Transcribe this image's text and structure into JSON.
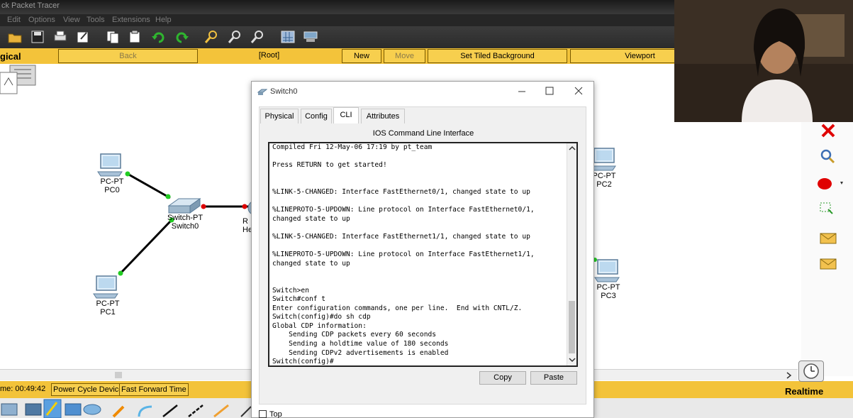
{
  "app": {
    "title_fragment": "ck Packet Tracer",
    "menu": [
      "Edit",
      "Options",
      "View",
      "Tools",
      "Extensions",
      "Help"
    ]
  },
  "workspace": {
    "mode_label": "gical",
    "nav": {
      "back": "Back",
      "root": "[Root]",
      "new_cluster": "New Cluster",
      "move_object": "Move Object",
      "set_tiled_background": "Set Tiled Background",
      "viewport": "Viewport"
    },
    "devices": [
      {
        "type": "PC-PT",
        "name": "PC0"
      },
      {
        "type": "PC-PT",
        "name": "PC1"
      },
      {
        "type": "Switch-PT",
        "name": "Switch0"
      },
      {
        "type": "PC-PT",
        "name": "PC2"
      },
      {
        "type": "PC-PT",
        "name": "PC3"
      }
    ],
    "partial_router_label": {
      "line1": "R",
      "line2": "He"
    }
  },
  "status": {
    "time": "me: 00:49:42",
    "power_cycle": "Power Cycle Devices",
    "fast_forward": "Fast Forward Time",
    "mode": "Realtime"
  },
  "colors": {
    "workspace_bar": "#f3c33a",
    "link_up": "#22cc22",
    "link_down": "#dd0000",
    "delete_tool": "#e00000"
  },
  "icons": {
    "palette": [
      "close-x-icon",
      "inspect-magnifier-icon",
      "draw-ellipse-icon",
      "resize-select-icon",
      "simple-pdu-icon",
      "complex-pdu-icon"
    ]
  },
  "dialog": {
    "title": "Switch0",
    "tabs": [
      "Physical",
      "Config",
      "CLI",
      "Attributes"
    ],
    "active_tab": "CLI",
    "heading": "IOS Command Line Interface",
    "terminal_lines": [
      "Compiled Fri 12-May-06 17:19 by pt_team",
      "",
      "Press RETURN to get started!",
      "",
      "",
      "%LINK-5-CHANGED: Interface FastEthernet0/1, changed state to up",
      "",
      "%LINEPROTO-5-UPDOWN: Line protocol on Interface FastEthernet0/1,",
      "changed state to up",
      "",
      "%LINK-5-CHANGED: Interface FastEthernet1/1, changed state to up",
      "",
      "%LINEPROTO-5-UPDOWN: Line protocol on Interface FastEthernet1/1,",
      "changed state to up",
      "",
      "",
      "Switch>en",
      "Switch#conf t",
      "Enter configuration commands, one per line.  End with CNTL/Z.",
      "Switch(config)#do sh cdp",
      "Global CDP information:",
      "    Sending CDP packets every 60 seconds",
      "    Sending a holdtime value of 180 seconds",
      "    Sending CDPv2 advertisements is enabled",
      "Switch(config)#"
    ],
    "copy_label": "Copy",
    "paste_label": "Paste",
    "top_checkbox_label": "Top",
    "top_checked": false
  }
}
